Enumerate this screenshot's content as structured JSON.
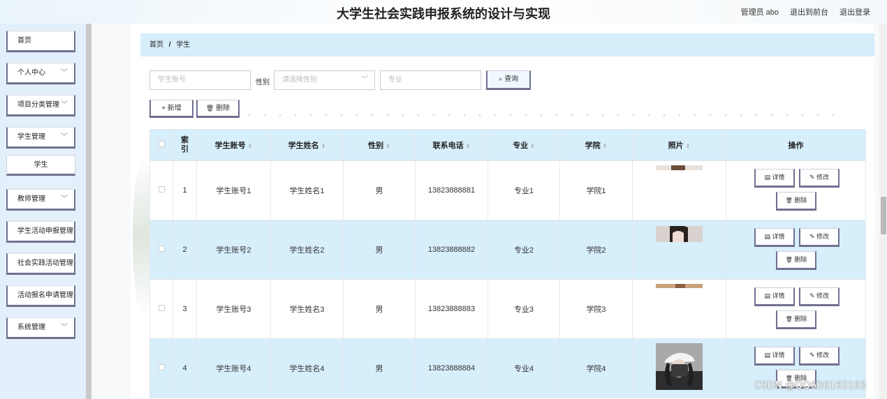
{
  "app": {
    "title": "大学生社会实践申报系统的设计与实现",
    "user_label": "管理员 abo",
    "front_link": "退出到前台",
    "logout_link": "退出登录"
  },
  "sidebar": {
    "items": [
      {
        "label": "首页",
        "has_chevron": false
      },
      {
        "label": "个人中心",
        "has_chevron": true
      },
      {
        "label": "项目分类管理",
        "has_chevron": true
      },
      {
        "label": "学生管理",
        "has_chevron": true
      },
      {
        "label": "教师管理",
        "has_chevron": true
      },
      {
        "label": "学生活动申报管理",
        "has_chevron": false
      },
      {
        "label": "社会实践活动管理",
        "has_chevron": false
      },
      {
        "label": "活动报名申请管理",
        "has_chevron": false
      },
      {
        "label": "系统管理",
        "has_chevron": true
      }
    ],
    "sub_item": "学生",
    "chevron_glyph": "﹀"
  },
  "breadcrumb": {
    "home": "首页",
    "separator": "/",
    "current": "学生"
  },
  "search": {
    "account_placeholder": "学生账号",
    "sex_label": "性别",
    "sex_placeholder": "请选择性别",
    "major_placeholder": "专业",
    "query_label": "查询",
    "query_icon": "⌕"
  },
  "actions": {
    "add_label": "新增",
    "add_icon": "+",
    "delete_label": "删除",
    "delete_icon": "🗑"
  },
  "table": {
    "headers": [
      "索引",
      "学生账号",
      "学生姓名",
      "性别",
      "联系电话",
      "专业",
      "学院",
      "照片",
      "操作"
    ],
    "sort_glyph": "⇕",
    "rows": [
      {
        "index": "1",
        "account": "学生账号1",
        "name": "学生姓名1",
        "sex": "男",
        "phone": "13823888881",
        "major": "专业1",
        "college": "学院1"
      },
      {
        "index": "2",
        "account": "学生账号2",
        "name": "学生姓名2",
        "sex": "男",
        "phone": "13823888882",
        "major": "专业2",
        "college": "学院2"
      },
      {
        "index": "3",
        "account": "学生账号3",
        "name": "学生姓名3",
        "sex": "男",
        "phone": "13823888883",
        "major": "专业3",
        "college": "学院3"
      },
      {
        "index": "4",
        "account": "学生账号4",
        "name": "学生姓名4",
        "sex": "男",
        "phone": "13823888884",
        "major": "专业4",
        "college": "学院4"
      }
    ],
    "op_detail": "详情",
    "op_edit": "修改",
    "op_delete": "删除",
    "op_detail_icon": "▤",
    "op_edit_icon": "✎",
    "op_delete_icon": "🗑"
  },
  "watermark": "CSDN @QQ626162193",
  "colors": {
    "accent": "#d7eefb",
    "button_border": "#6f7090",
    "sidebar_bg": "#e3f0fb"
  }
}
